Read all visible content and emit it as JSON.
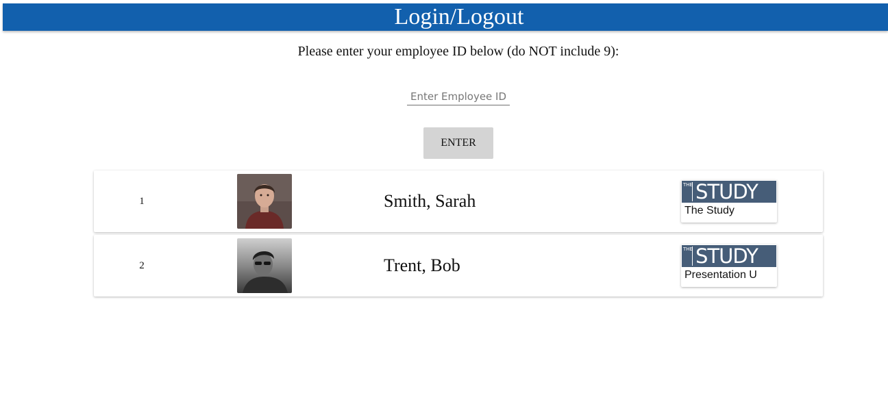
{
  "header": {
    "title": "Login/Logout"
  },
  "login": {
    "instruction": "Please enter your employee ID below (do NOT include 9):",
    "input_value": "",
    "input_placeholder": "Enter Employee ID",
    "enter_label": "ENTER"
  },
  "employees": [
    {
      "number": "1",
      "name": "Smith, Sarah",
      "logo_the": "THE",
      "logo_word": "STUDY",
      "location": "The Study"
    },
    {
      "number": "2",
      "name": "Trent, Bob",
      "logo_the": "THE",
      "logo_word": "STUDY",
      "location": "Presentation U"
    }
  ],
  "colors": {
    "header_bg": "#1260ad",
    "button_bg": "#d4d4d4",
    "logo_bg": "#465d78"
  },
  "icons": {
    "avatar_1": "person-photo",
    "avatar_2": "person-photo",
    "logo": "the-study-logo"
  }
}
